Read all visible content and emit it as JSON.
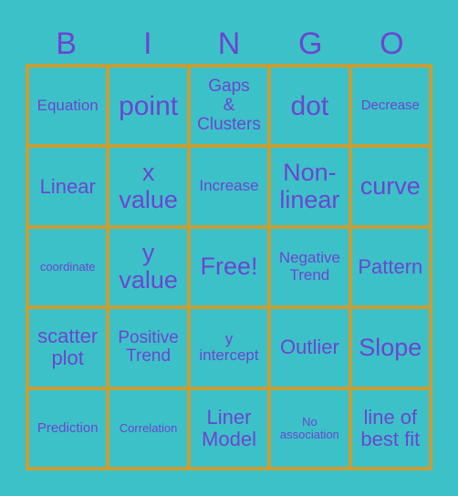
{
  "header": [
    "B",
    "I",
    "N",
    "G",
    "O"
  ],
  "cells": [
    {
      "text": "Equation",
      "size": "s-s"
    },
    {
      "text": "point",
      "size": "s-xl"
    },
    {
      "text": "Gaps & Clusters",
      "size": "s-sm",
      "lines": [
        "Gaps",
        "&",
        "Clusters"
      ]
    },
    {
      "text": "dot",
      "size": "s-xl"
    },
    {
      "text": "Decrease",
      "size": "s-xs"
    },
    {
      "text": "Linear",
      "size": "s-m"
    },
    {
      "text": "x value",
      "size": "s-l",
      "lines": [
        "x",
        "value"
      ]
    },
    {
      "text": "Increase",
      "size": "s-s"
    },
    {
      "text": "Non-linear",
      "size": "s-l",
      "lines": [
        "Non-",
        "linear"
      ]
    },
    {
      "text": "curve",
      "size": "s-l"
    },
    {
      "text": "coordinate",
      "size": "s-xxs"
    },
    {
      "text": "y value",
      "size": "s-l",
      "lines": [
        "y",
        "value"
      ]
    },
    {
      "text": "Free!",
      "size": "s-l"
    },
    {
      "text": "Negative Trend",
      "size": "s-s",
      "lines": [
        "Negative",
        "Trend"
      ]
    },
    {
      "text": "Pattern",
      "size": "s-m"
    },
    {
      "text": "scatter plot",
      "size": "s-m",
      "lines": [
        "scatter",
        "plot"
      ]
    },
    {
      "text": "Positive Trend",
      "size": "s-sm",
      "lines": [
        "Positive",
        "Trend"
      ]
    },
    {
      "text": "y intercept",
      "size": "s-s",
      "lines": [
        "y",
        "intercept"
      ]
    },
    {
      "text": "Outlier",
      "size": "s-m"
    },
    {
      "text": "Slope",
      "size": "s-l"
    },
    {
      "text": "Prediction",
      "size": "s-xs"
    },
    {
      "text": "Correlation",
      "size": "s-xxs"
    },
    {
      "text": "Liner Model",
      "size": "s-m",
      "lines": [
        "Liner",
        "Model"
      ]
    },
    {
      "text": "No association",
      "size": "s-xxs",
      "lines": [
        "No",
        "association"
      ]
    },
    {
      "text": "line of best fit",
      "size": "s-m",
      "lines": [
        "line of",
        "best fit"
      ]
    }
  ],
  "colors": {
    "background": "#3dc1c8",
    "border": "#c89e35",
    "text": "#6a46d0"
  }
}
